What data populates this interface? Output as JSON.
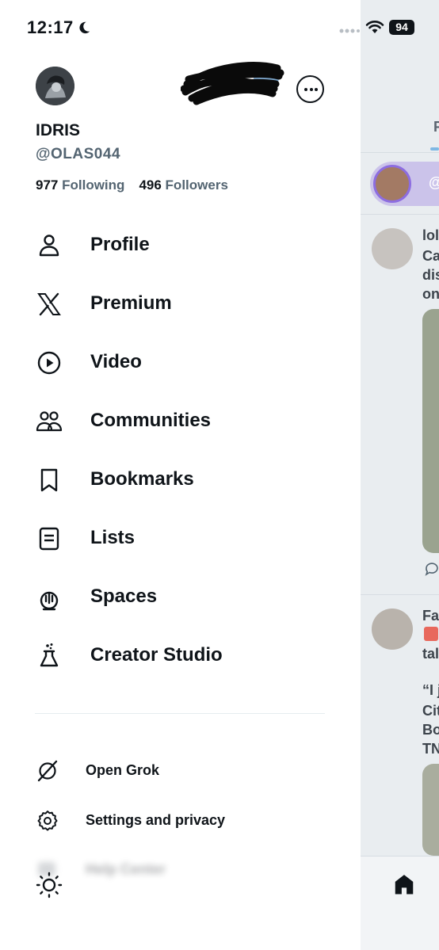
{
  "status_bar": {
    "time": "12:17",
    "battery": "94"
  },
  "profile": {
    "name": "IDRIS",
    "handle": "@OLAS044",
    "following_count": "977",
    "following_label": "Following",
    "followers_count": "496",
    "followers_label": "Followers"
  },
  "menu": [
    {
      "label": "Profile",
      "icon": "person-icon"
    },
    {
      "label": "Premium",
      "icon": "x-logo-icon"
    },
    {
      "label": "Video",
      "icon": "play-circle-icon"
    },
    {
      "label": "Communities",
      "icon": "communities-icon"
    },
    {
      "label": "Bookmarks",
      "icon": "bookmark-icon"
    },
    {
      "label": "Lists",
      "icon": "list-icon"
    },
    {
      "label": "Spaces",
      "icon": "spaces-icon"
    },
    {
      "label": "Creator Studio",
      "icon": "flask-icon"
    }
  ],
  "secondary_menu": [
    {
      "label": "Open Grok",
      "icon": "grok-icon"
    },
    {
      "label": "Settings and privacy",
      "icon": "gear-icon"
    },
    {
      "label": "Help Center",
      "icon": "help-icon"
    }
  ],
  "feed_preview": {
    "tab_initial": "F",
    "space_handle": "@",
    "post1_lines": [
      "lol",
      "Ca",
      "dis",
      "on"
    ],
    "post2_lines": [
      "Fa",
      "",
      "tal"
    ],
    "post2_quote": [
      "“I j",
      "Cit",
      "Bo",
      "TN"
    ]
  },
  "colors": {
    "accent": "#1d9bf0",
    "secondary_text": "#536471",
    "text": "#0f1419"
  }
}
